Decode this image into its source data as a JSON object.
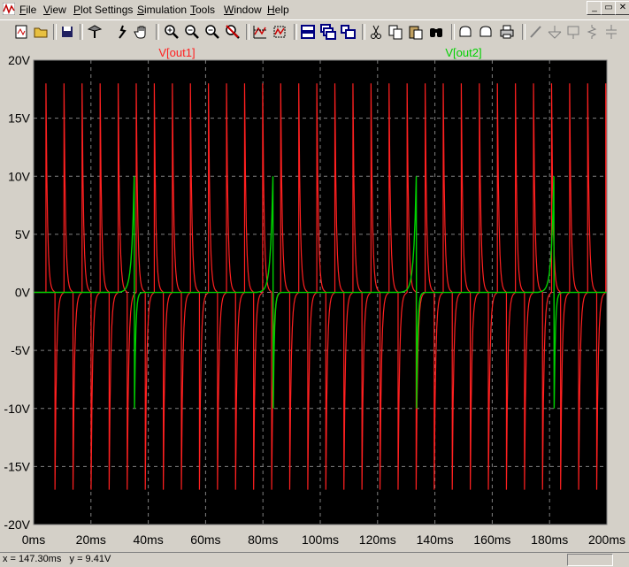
{
  "menubar": {
    "items": [
      {
        "label": "File",
        "key": "F"
      },
      {
        "label": "View",
        "key": "V"
      },
      {
        "label": "Plot Settings",
        "key": "P"
      },
      {
        "label": "Simulation",
        "key": "S"
      },
      {
        "label": "Tools",
        "key": "T"
      },
      {
        "label": "Window",
        "key": "W"
      },
      {
        "label": "Help",
        "key": "H"
      }
    ],
    "window_controls": [
      "_",
      "▭",
      "✕"
    ]
  },
  "toolbar": {
    "buttons": [
      "new-schematic-icon",
      "open-icon",
      "save-icon",
      "control-panel-icon",
      "run-icon",
      "pan-hand-icon",
      "zoom-in-icon",
      "zoom-out-icon",
      "zoom-full-icon",
      "cancel-zoom-icon",
      "autorange-icon",
      "vertical-autorange-icon",
      "tile-horizontal-icon",
      "cascade-icon",
      "tile-vertical-icon",
      "cut-icon",
      "copy-icon",
      "paste-icon",
      "find-icon",
      "undo-icon",
      "redo-icon",
      "print-icon",
      "wire-icon",
      "ground-icon",
      "label-icon",
      "resistor-icon",
      "capacitor-icon"
    ]
  },
  "status": {
    "text": "x = 147.30ms   y = 9.41V"
  },
  "chart_data": {
    "type": "line",
    "x_unit": "ms",
    "xlim": [
      0,
      200
    ],
    "ylim": [
      -20,
      20
    ],
    "x_ticks": [
      "0ms",
      "20ms",
      "40ms",
      "60ms",
      "80ms",
      "100ms",
      "120ms",
      "140ms",
      "160ms",
      "180ms",
      "200ms"
    ],
    "y_ticks": [
      "20V",
      "15V",
      "10V",
      "5V",
      "0V",
      "-5V",
      "-10V",
      "-15V",
      "-20V"
    ],
    "grid": true,
    "series": [
      {
        "name": "V[out1]",
        "color": "#ff2020",
        "period_ms": 6.3,
        "first_spike_ms": 4.3,
        "positive_peak": 18,
        "negative_peak": -17,
        "decay_ms": 1.5
      },
      {
        "name": "V[out2]",
        "color": "#00d000",
        "spike_times_ms": [
          35.1,
          83.5,
          133.5,
          181.5
        ],
        "positive_peak": 10,
        "negative_peak": -10,
        "rise_ms": 2.5,
        "decay_ms": 1.2
      }
    ]
  }
}
